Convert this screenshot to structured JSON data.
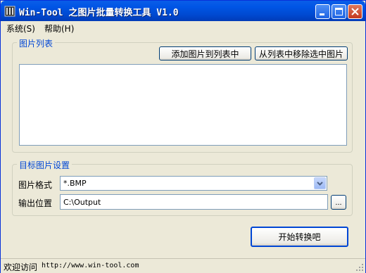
{
  "window": {
    "title": "Win-Tool 之图片批量转换工具 V1.0"
  },
  "menu": {
    "items": [
      {
        "label": "系统(S)"
      },
      {
        "label": "帮助(H)"
      }
    ]
  },
  "image_list_group": {
    "title": "图片列表",
    "add_button": "添加图片到列表中",
    "remove_button": "从列表中移除选中图片",
    "items": []
  },
  "target_group": {
    "title": "目标图片设置",
    "format_label": "图片格式",
    "format_value": "*.BMP",
    "output_label": "输出位置",
    "output_value": "C:\\Output",
    "browse_button": "..."
  },
  "start_button": "开始转换吧",
  "status": {
    "label": "欢迎访问",
    "url": "http://www.win-tool.com"
  },
  "icons": {
    "app": "app-icon",
    "minimize": "minimize-icon",
    "maximize": "maximize-icon",
    "close": "close-icon",
    "dropdown": "chevron-down-icon",
    "grip": "resize-grip-icon"
  },
  "colors": {
    "titlebar": "#0055e5",
    "window_bg": "#ece9d8",
    "group_title": "#0046d5",
    "close_button": "#c4391f"
  }
}
